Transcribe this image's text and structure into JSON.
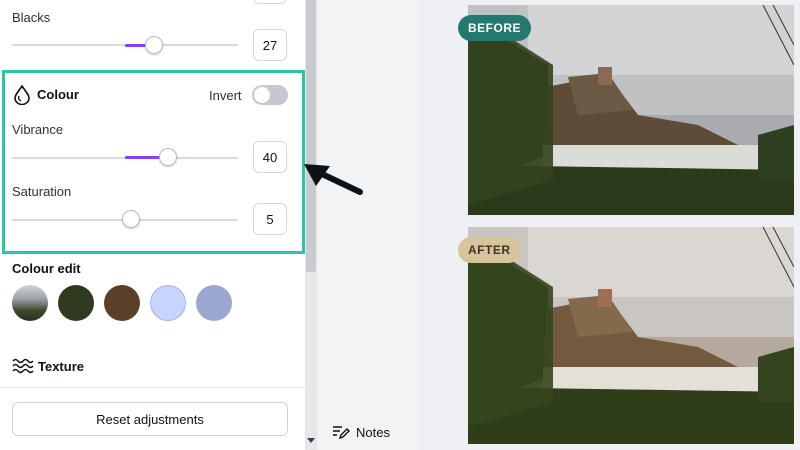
{
  "panel": {
    "blacks": {
      "label": "Blacks",
      "value": "27"
    },
    "colour_section": {
      "title": "Colour",
      "invert_label": "Invert",
      "invert_on": false
    },
    "vibrance": {
      "label": "Vibrance",
      "value": "40"
    },
    "saturation": {
      "label": "Saturation",
      "value": "5"
    },
    "colour_edit": {
      "title": "Colour edit",
      "swatches": [
        "photo-swatch",
        "#2f3a1e",
        "#5b3f28",
        "#c8d4fb",
        "#9aa7d0"
      ]
    },
    "texture": {
      "title": "Texture"
    },
    "reset_label": "Reset adjustments"
  },
  "notes_label": "Notes",
  "canvas": {
    "before_label": "BEFORE",
    "after_label": "AFTER",
    "before_badge_color": "#23786f",
    "after_badge_color": "#d7c49a"
  },
  "accent_color": "#8b3dff",
  "highlight_color": "#2ac6a7"
}
